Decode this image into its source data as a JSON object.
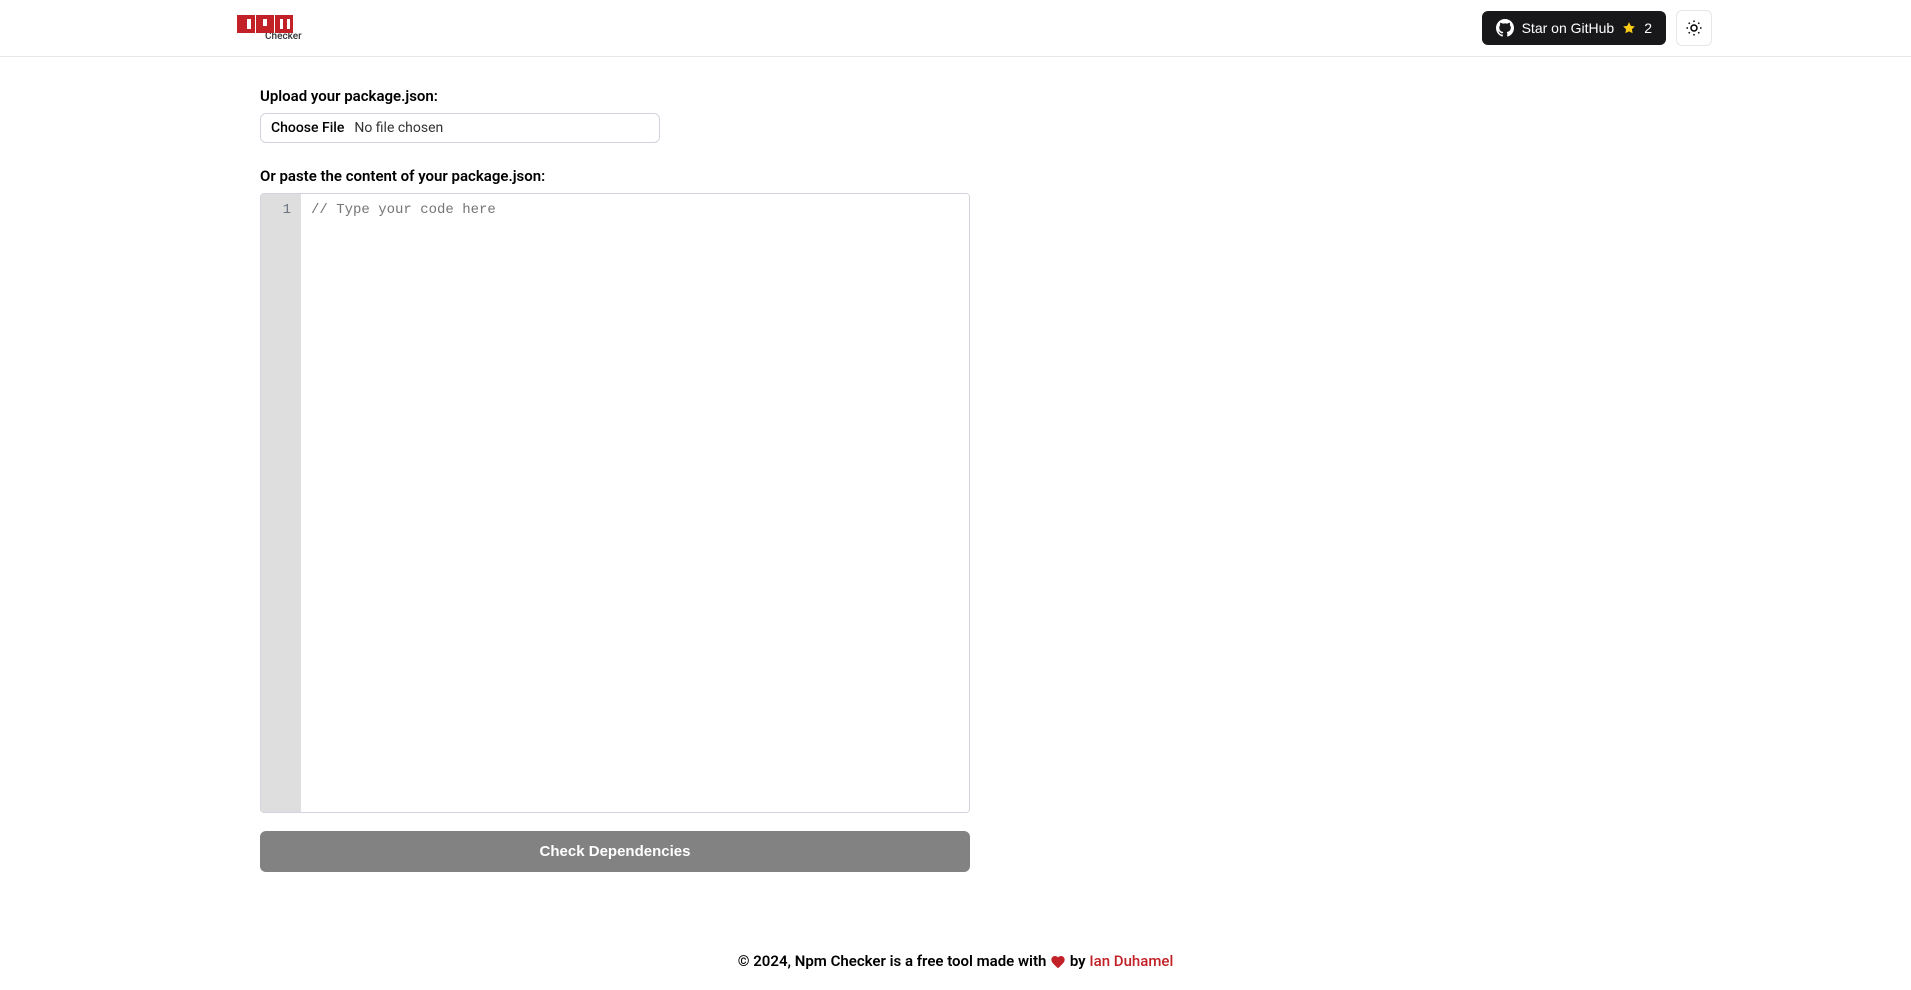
{
  "header": {
    "logo_subtext": "Checker",
    "github_label": "Star on GitHub",
    "star_count": "2"
  },
  "upload": {
    "label": "Upload your package.json:",
    "choose_file": "Choose File",
    "no_file": "No file chosen"
  },
  "paste": {
    "label": "Or paste the content of your package.json:",
    "line_number": "1",
    "placeholder": "// Type your code here"
  },
  "check_button": "Check Dependencies",
  "footer": {
    "text_before": "© 2024, Npm Checker is a free tool made with ",
    "text_by": " by ",
    "author": "Ian Duhamel"
  }
}
